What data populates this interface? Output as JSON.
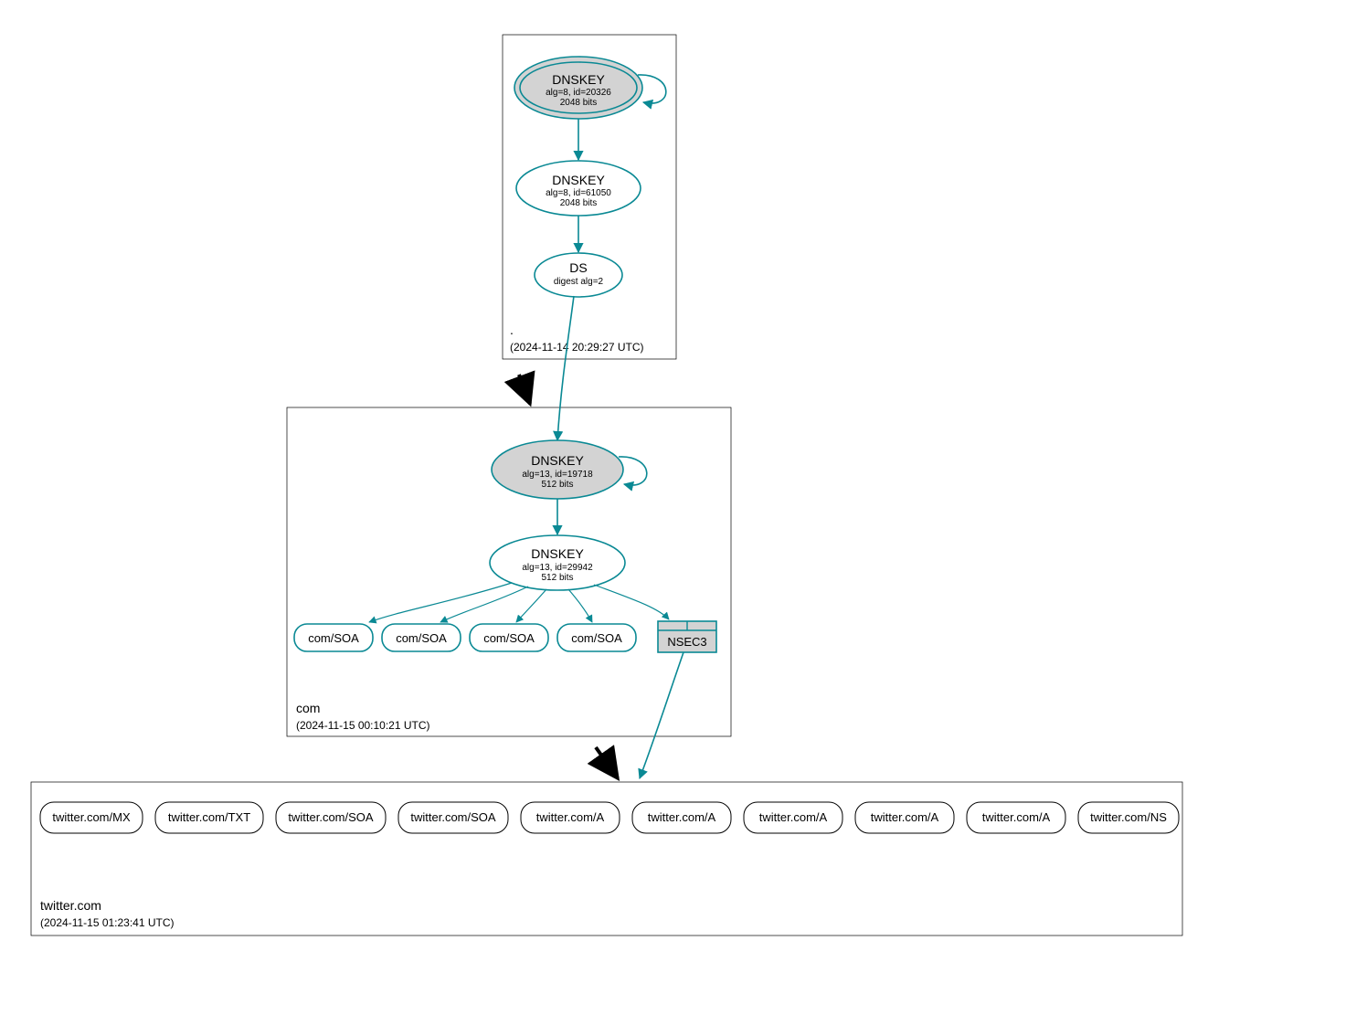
{
  "colors": {
    "teal": "#0a8994",
    "gray": "#d3d3d3",
    "black": "#000000"
  },
  "zones": {
    "root": {
      "title": ".",
      "timestamp": "(2024-11-14 20:29:27 UTC)"
    },
    "com": {
      "title": "com",
      "timestamp": "(2024-11-15 00:10:21 UTC)"
    },
    "leaf": {
      "title": "twitter.com",
      "timestamp": "(2024-11-15 01:23:41 UTC)"
    }
  },
  "root": {
    "ksk": {
      "title": "DNSKEY",
      "sub1": "alg=8, id=20326",
      "sub2": "2048 bits"
    },
    "zsk": {
      "title": "DNSKEY",
      "sub1": "alg=8, id=61050",
      "sub2": "2048 bits"
    },
    "ds": {
      "title": "DS",
      "sub1": "digest alg=2"
    }
  },
  "com": {
    "ksk": {
      "title": "DNSKEY",
      "sub1": "alg=13, id=19718",
      "sub2": "512 bits"
    },
    "zsk": {
      "title": "DNSKEY",
      "sub1": "alg=13, id=29942",
      "sub2": "512 bits"
    },
    "soa0": "com/SOA",
    "soa1": "com/SOA",
    "soa2": "com/SOA",
    "soa3": "com/SOA",
    "nsec3": "NSEC3"
  },
  "leaf": {
    "r0": "twitter.com/MX",
    "r1": "twitter.com/TXT",
    "r2": "twitter.com/SOA",
    "r3": "twitter.com/SOA",
    "r4": "twitter.com/A",
    "r5": "twitter.com/A",
    "r6": "twitter.com/A",
    "r7": "twitter.com/A",
    "r8": "twitter.com/A",
    "r9": "twitter.com/NS"
  }
}
